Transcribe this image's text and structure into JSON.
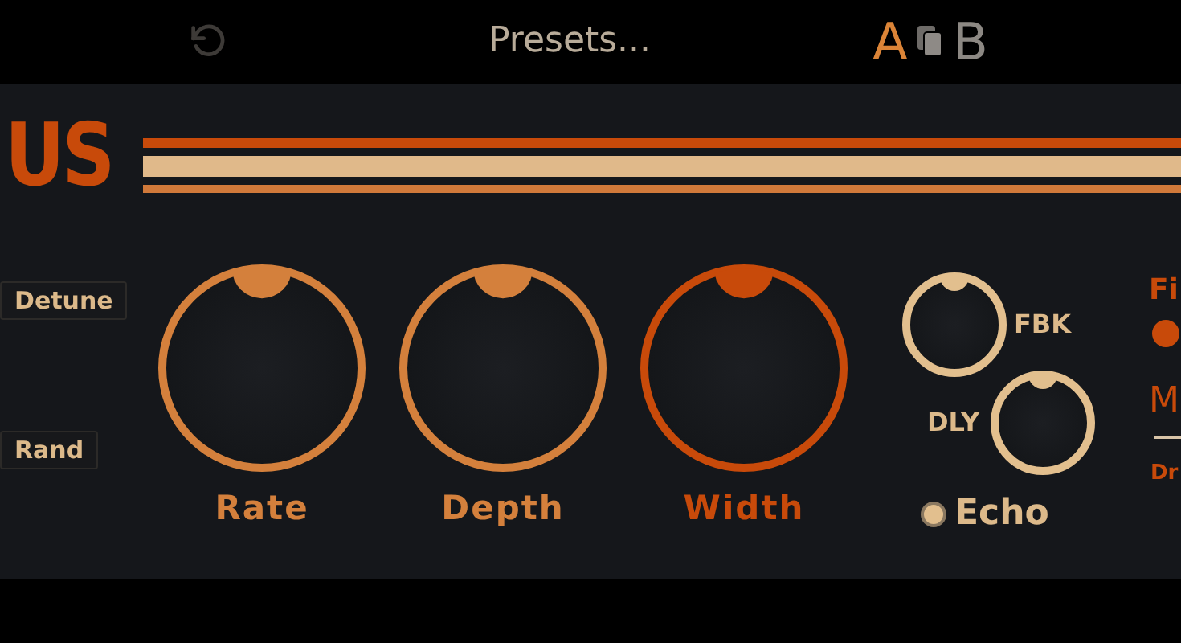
{
  "toolbar": {
    "presets_label": "Presets...",
    "ab": [
      {
        "label": "A",
        "selected": true
      },
      {
        "label": "B",
        "selected": false
      }
    ]
  },
  "title": "US",
  "buttons": [
    {
      "label": "Detune"
    },
    {
      "label": "Rand"
    }
  ],
  "knobs": [
    {
      "label": "Rate",
      "color": "#d4803c"
    },
    {
      "label": "Depth",
      "color": "#d4803c"
    },
    {
      "label": "Width",
      "color": "#c84a0a"
    }
  ],
  "echo": {
    "knobs": [
      {
        "label": "FBK"
      },
      {
        "label": "DLY"
      }
    ],
    "toggle": {
      "label": "Echo",
      "on": true
    }
  },
  "right_edge": {
    "filter_label": "Fi",
    "filter_on": true,
    "mix_label": "M",
    "mix_value_label": "Dr"
  }
}
